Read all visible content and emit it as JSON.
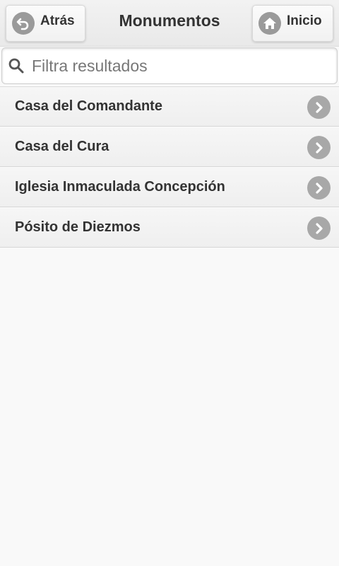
{
  "header": {
    "title": "Monumentos",
    "back_label": "Atrás",
    "home_label": "Inicio"
  },
  "search": {
    "placeholder": "Filtra resultados",
    "value": ""
  },
  "list": {
    "items": [
      {
        "label": "Casa del Comandante"
      },
      {
        "label": "Casa del Cura"
      },
      {
        "label": "Iglesia Inmaculada Concepción"
      },
      {
        "label": "Pósito de Diezmos"
      }
    ]
  },
  "icons": {
    "back": "back-arrow-icon",
    "home": "home-icon",
    "search": "search-icon",
    "chevron": "chevron-right-icon"
  },
  "colors": {
    "background": "#f9f9f9",
    "header": "#ececec",
    "icon_circle": "#9a9a9a",
    "text": "#333333"
  }
}
